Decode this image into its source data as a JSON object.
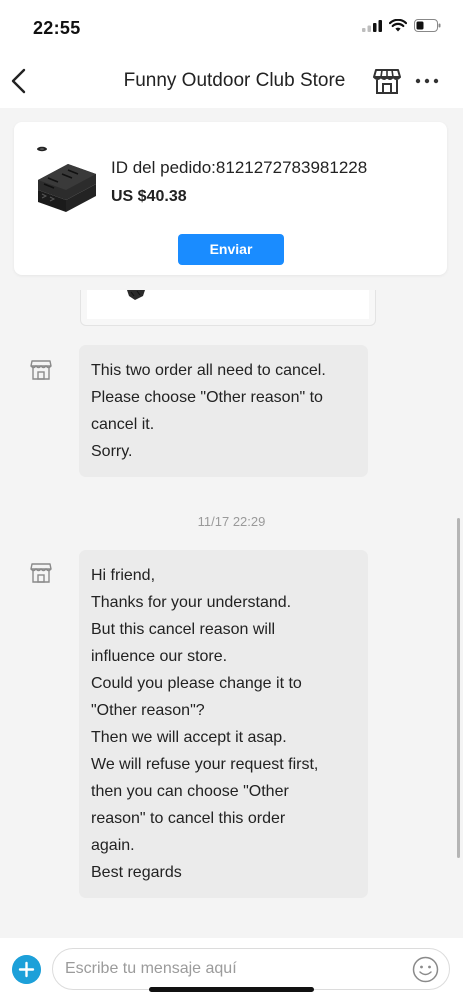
{
  "status_bar": {
    "time": "22:55",
    "icons": [
      "signal-icon",
      "wifi-icon",
      "battery-icon"
    ]
  },
  "header": {
    "title": "Funny Outdoor Club Store",
    "back_icon": "chevron-left-icon",
    "store_icon": "store-icon",
    "more_icon": "more-dots-icon"
  },
  "order_card": {
    "order_id": "ID del pedido:8121272783981228",
    "price": "US $40.38",
    "send_label": "Enviar",
    "send_color": "#1a8cff"
  },
  "messages": [
    {
      "sender_icon": "store-icon",
      "lines": [
        "This two order all need to cancel.",
        "Please choose \"Other reason\" to",
        "cancel it.",
        "Sorry."
      ]
    },
    {
      "sender_icon": "store-icon",
      "lines": [
        "Hi friend,",
        "Thanks for your understand.",
        "But this cancel reason will",
        "influence our store.",
        "Could you please change it to",
        "\"Other reason\"?",
        "Then we will accept it asap.",
        "We will refuse your request first,",
        "then you can choose \"Other",
        "reason\" to cancel this order",
        "again.",
        "Best regards"
      ]
    }
  ],
  "timestamp": "11/17 22:29",
  "input_bar": {
    "placeholder": "Escribe tu mensaje aquí",
    "add_icon": "plus-icon",
    "emoji_icon": "emoji-icon",
    "add_color": "#1da0d9"
  },
  "colors": {
    "chat_background": "#f4f4f4",
    "bubble": "#ebebeb"
  }
}
